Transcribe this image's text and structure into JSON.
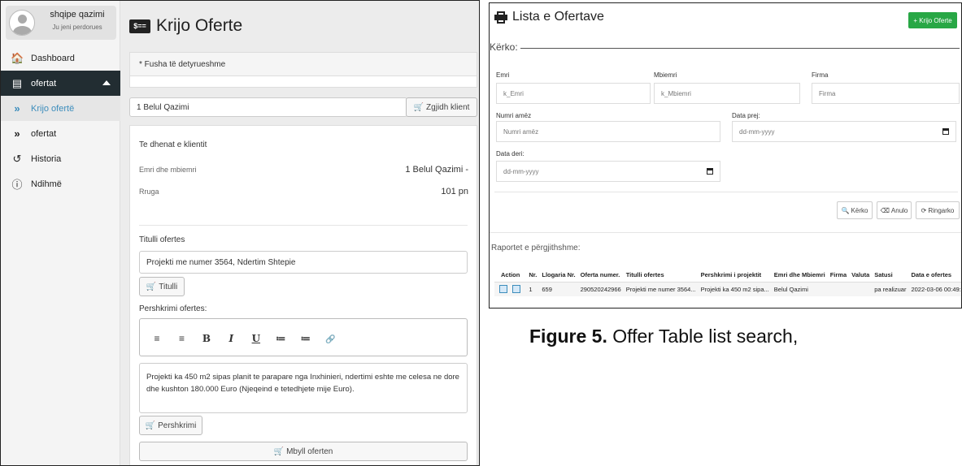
{
  "left_screen": {
    "user": {
      "name": "shqipe qazimi",
      "subtitle": "Ju jeni perdorues"
    },
    "sidebar": {
      "items": [
        {
          "label": "Dashboard",
          "icon": "home-icon"
        },
        {
          "label": "ofertat",
          "icon": "list-icon"
        },
        {
          "label": "Krijo ofertë",
          "icon": "double-chevron-right-icon"
        },
        {
          "label": "ofertat",
          "icon": "double-chevron-right-icon"
        },
        {
          "label": "Historia",
          "icon": "history-icon"
        },
        {
          "label": "Ndihmë",
          "icon": "info-icon"
        }
      ]
    },
    "page_title": "Krijo Oferte",
    "title_icon_text": "$==",
    "required_note": "* Fusha të detyrueshme",
    "client_field_value": "1 Belul Qazimi",
    "choose_client_button": "Zgjidh klient",
    "client_section_title": "Te dhenat e klientit",
    "client_rows": [
      {
        "label": "Emri dhe mbiemri",
        "value": "1 Belul Qazimi -"
      },
      {
        "label": "Rruga",
        "value": "101 pn"
      }
    ],
    "offer_title_label": "Titulli ofertes",
    "offer_title_value": "Projekti me numer 3564, Ndertim Shtepie",
    "title_button": "Titulli",
    "description_label": "Pershkrimi ofertes:",
    "toolbar_buttons": [
      "≡",
      "≡",
      "B",
      "I",
      "U",
      "≔",
      "≔",
      "🔗"
    ],
    "description_value": "Projekti ka 450 m2 sipas planit te parapare nga Inxhinieri, ndertimi eshte me celesa ne dore dhe kushton 180.000 Euro (Njeqeind e tetedhjete mije Euro).",
    "description_button": "Pershkrimi",
    "close_offer_button": "Mbyll oferten"
  },
  "right_screen": {
    "title": "Lista e Ofertave",
    "create_button": "+ Krijo Oferte",
    "search_legend": "Kërko:",
    "fields": {
      "emri_label": "Emri",
      "emri_placeholder": "k_Emri",
      "mbiemri_label": "Mbiemri",
      "mbiemri_placeholder": "k_Mbiemri",
      "firma_label": "Firma",
      "firma_placeholder": "Firma",
      "numri_label": "Numri amëz",
      "numri_placeholder": "Numri amëz",
      "data_prej_label": "Data prej:",
      "data_prej_placeholder": "dd-mm-yyyy",
      "data_deri_label": "Data deri:",
      "data_deri_placeholder": "dd-mm-yyyy"
    },
    "buttons": {
      "search": "Kërko",
      "cancel": "Anulo",
      "reload": "Ringarko"
    },
    "reports_title": "Raportet e përgjithshme:",
    "table": {
      "headers": [
        "Action",
        "Nr.",
        "Llogaria Nr.",
        "Oferta numer.",
        "Titulli ofertes",
        "Pershkrimi i projektit",
        "Emri dhe Mbiemri",
        "Firma",
        "Valuta",
        "Satusi",
        "Data e ofertes"
      ],
      "rows": [
        [
          "",
          "1",
          "659",
          "290520242966",
          "Projekti me numer 3564...",
          "Projekti ka 450 m2 sipa...",
          "Belul Qazimi",
          "",
          "",
          "pa realizuar",
          "2022-03-06 00:49:37"
        ]
      ]
    }
  },
  "caption": {
    "label": "Figure 5.",
    "text": "Offer Table list search,"
  }
}
